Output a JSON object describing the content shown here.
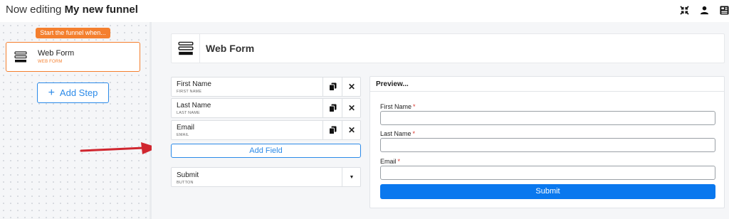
{
  "header": {
    "title_prefix": "Now editing",
    "funnel_name": "My new funnel",
    "icons": [
      "collapse-icon",
      "user-icon",
      "preview-layout-icon"
    ]
  },
  "canvas": {
    "trigger_label": "Start the funnel when...",
    "step": {
      "name": "Web Form",
      "type": "WEB FORM",
      "icon": "form-icon"
    },
    "add_step_label": "Add Step"
  },
  "editor": {
    "title": "Web Form",
    "fields": [
      {
        "label": "First Name",
        "sub": "FIRST NAME"
      },
      {
        "label": "Last Name",
        "sub": "LAST NAME"
      },
      {
        "label": "Email",
        "sub": "EMAIL"
      }
    ],
    "add_field_label": "Add Field",
    "submit": {
      "label": "Submit",
      "sub": "BUTTON"
    }
  },
  "preview": {
    "title": "Preview...",
    "fields": [
      {
        "label": "First Name",
        "required_mark": "*"
      },
      {
        "label": "Last Name",
        "required_mark": "*"
      },
      {
        "label": "Email",
        "required_mark": "*"
      }
    ],
    "submit_label": "Submit"
  },
  "colors": {
    "accent_orange": "#f47f2e",
    "accent_blue": "#2b8ae8",
    "submit_blue": "#0a78ee",
    "annotation_arrow": "#d0262f"
  }
}
